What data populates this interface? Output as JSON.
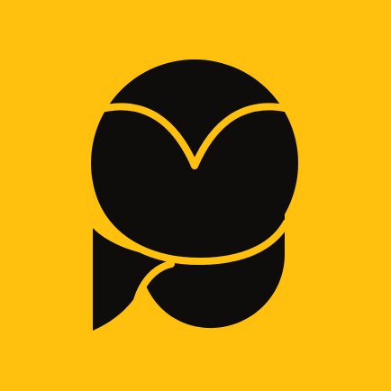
{
  "app_icon": {
    "icon": "owl-logo-icon",
    "colors": {
      "background": "#FFC00E",
      "mark": "#0E0D0C",
      "outline": "#FFC00E"
    }
  }
}
